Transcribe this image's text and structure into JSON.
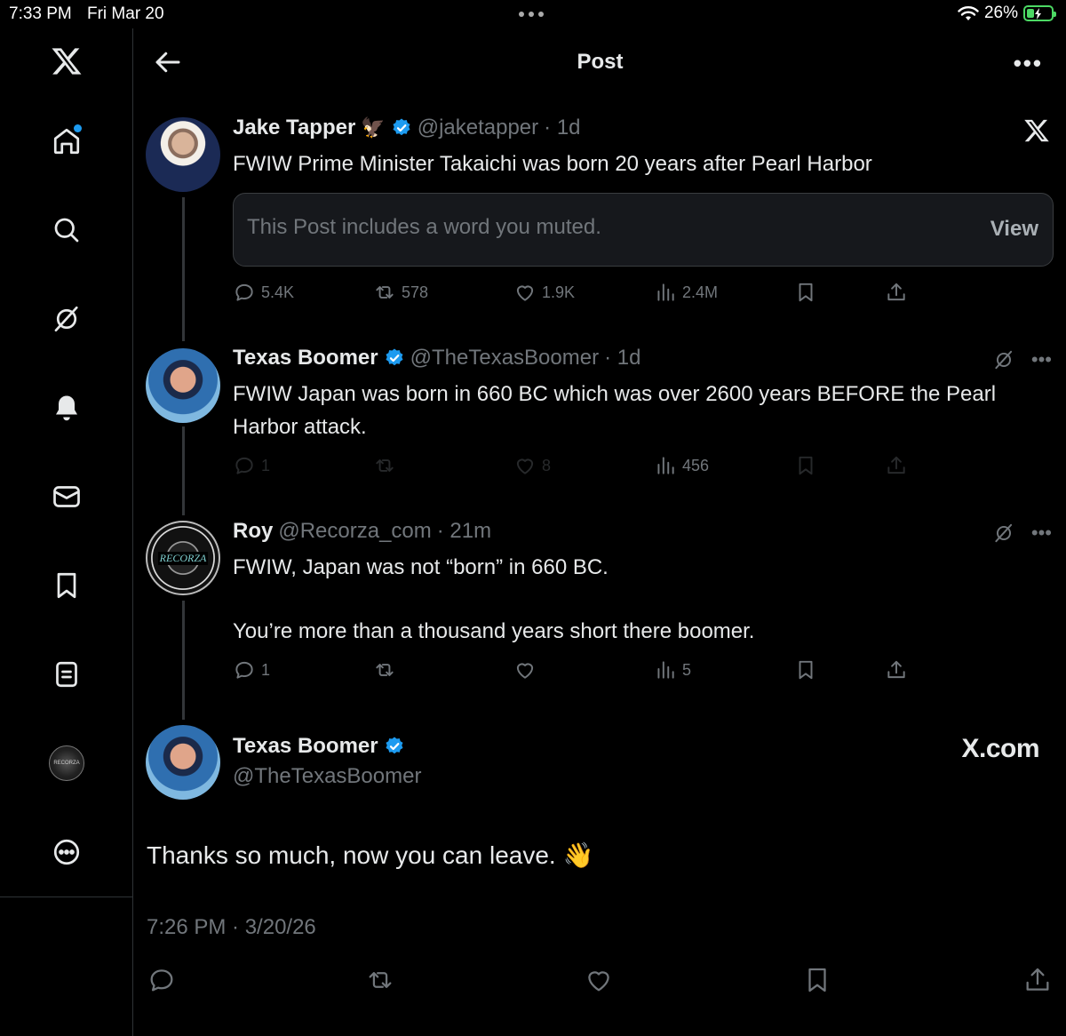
{
  "status_bar": {
    "time": "7:33 PM",
    "date": "Fri Mar 20",
    "battery": "26%"
  },
  "sidebar": {
    "items": [
      {
        "icon": "x-logo-icon"
      },
      {
        "icon": "home-icon"
      },
      {
        "icon": "search-icon"
      },
      {
        "icon": "grok-icon"
      },
      {
        "icon": "bell-icon"
      },
      {
        "icon": "mail-icon"
      },
      {
        "icon": "bookmark-icon"
      },
      {
        "icon": "list-icon"
      },
      {
        "icon": "profile-avatar"
      },
      {
        "icon": "more-circle-icon"
      }
    ],
    "avatar_text": "RECORZA"
  },
  "header": {
    "title": "Post",
    "more": "•••"
  },
  "posts": [
    {
      "name": "Jake Tapper",
      "emoji": "🦅",
      "handle": "@jaketapper",
      "time": "· 1d",
      "text": "FWIW Prime Minister Takaichi was born 20 years after Pearl Harbor",
      "muted_text": "This Post includes a word you muted.",
      "view_label": "View",
      "replies": "5.4K",
      "reposts": "578",
      "likes": "1.9K",
      "views": "2.4M"
    },
    {
      "name": "Texas Boomer",
      "handle": "@TheTexasBoomer",
      "time": "· 1d",
      "text": "FWIW Japan was born in 660 BC which was over 2600 years BEFORE the Pearl Harbor attack.",
      "replies": "1",
      "reposts": "",
      "likes": "8",
      "views": "456",
      "more": "•••"
    },
    {
      "name": "Roy",
      "handle": "@Recorza_com",
      "time": "· 21m",
      "avatar_text": "RECORZA",
      "text_1": "FWIW, Japan was not “born” in 660 BC.",
      "text_2": "You’re more than a thousand years short there boomer.",
      "replies": "1",
      "reposts": "",
      "likes": "",
      "views": "5",
      "more": "•••"
    }
  ],
  "focal_post": {
    "name": "Texas Boomer",
    "handle": "@TheTexasBoomer",
    "watermark": "X.com",
    "text": "Thanks so much, now you can leave. 👋",
    "timestamp": "7:26 PM · 3/20/26"
  },
  "colors": {
    "background": "#000000",
    "verified": "#1d9bf0",
    "secondary_text": "#71767b",
    "divider": "#2f3336"
  }
}
